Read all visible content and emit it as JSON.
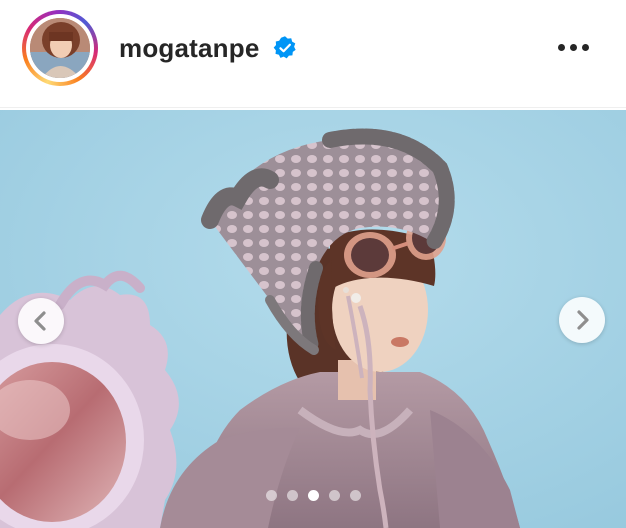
{
  "post": {
    "username": "mogatanpe",
    "verified": true,
    "avatar_icon": "profile-photo",
    "more_icon": "more-horizontal-icon"
  },
  "carousel": {
    "prev_icon": "chevron-left-icon",
    "next_icon": "chevron-right-icon",
    "slide_count": 5,
    "active_index": 2
  },
  "colors": {
    "background_blue": "#a9d6e9",
    "verified_blue": "#0095f6",
    "text": "#262626"
  }
}
